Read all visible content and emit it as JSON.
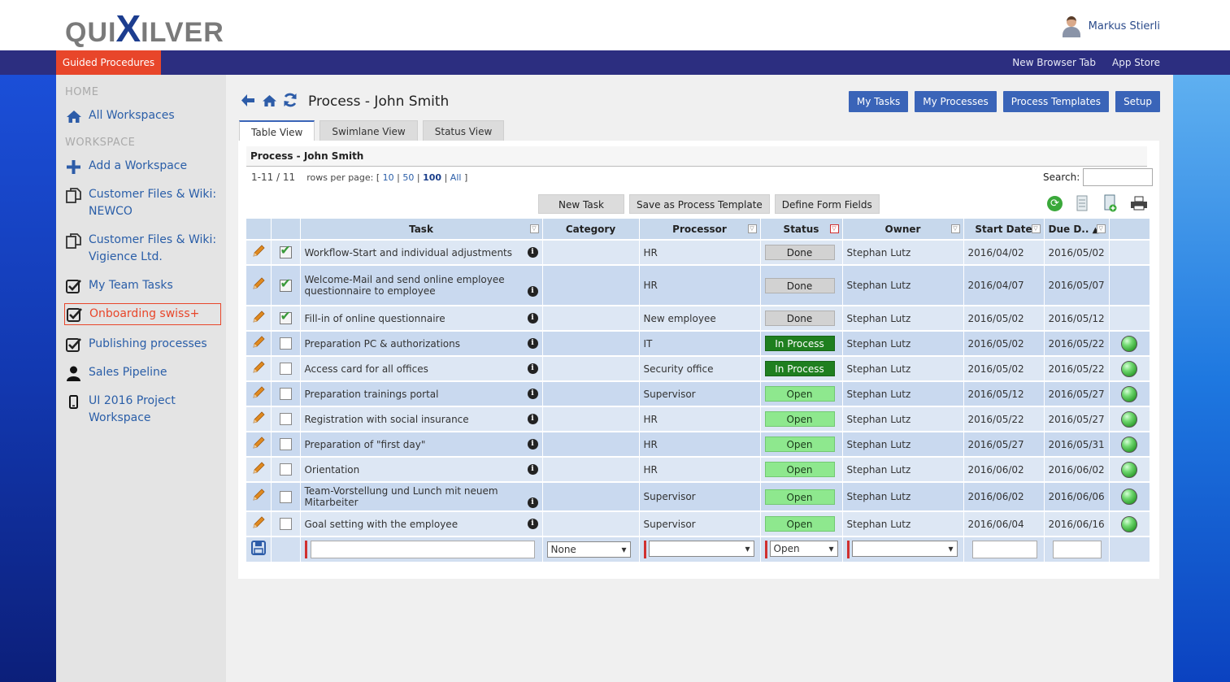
{
  "header": {
    "logo_pre": "QUI",
    "logo_x": "X",
    "logo_post": "ILVER",
    "user_name": "Markus Stierli"
  },
  "nav": {
    "active": "Guided Procedures",
    "links": [
      "New Browser Tab",
      "App Store"
    ]
  },
  "sidebar": {
    "home_label": "HOME",
    "workspace_label": "WORKSPACE",
    "items": [
      {
        "label": "All Workspaces",
        "icon": "home-icon"
      },
      {
        "label": "Add a Workspace",
        "icon": "plus-icon"
      },
      {
        "label": "Customer Files & Wiki: NEWCO",
        "icon": "copy-icon"
      },
      {
        "label": "Customer Files & Wiki: Vigience Ltd.",
        "icon": "copy-icon"
      },
      {
        "label": "My Team Tasks",
        "icon": "checkbox-icon"
      },
      {
        "label": "Onboarding swiss+",
        "icon": "checkbox-icon"
      },
      {
        "label": "Publishing processes",
        "icon": "checkbox-icon"
      },
      {
        "label": "Sales Pipeline",
        "icon": "user-icon"
      },
      {
        "label": "UI 2016 Project Workspace",
        "icon": "mobile-icon"
      }
    ]
  },
  "main": {
    "title": "Process - John Smith",
    "top_buttons": [
      "My Tasks",
      "My Processes",
      "Process Templates",
      "Setup"
    ],
    "tabs": [
      "Table View",
      "Swimlane View",
      "Status View"
    ],
    "panel_title": "Process - John Smith",
    "pager": {
      "count": "1-11 / 11",
      "rows_label": "rows per page: [",
      "opt10": "10",
      "opt50": "50",
      "opt100": "100",
      "optAll": "All",
      "sep": "|",
      "close": "]"
    },
    "search_label": "Search:",
    "actions": [
      "New Task",
      "Save as Process Template",
      "Define Form Fields"
    ]
  },
  "table": {
    "headers": [
      "Task",
      "Category",
      "Processor",
      "Status",
      "Owner",
      "Start Date",
      "Due D.."
    ],
    "rows": [
      {
        "task": "Workflow-Start and individual adjustments",
        "category": "",
        "processor": "HR",
        "status": "Done",
        "owner": "Stephan Lutz",
        "start": "2016/04/02",
        "due": "2016/05/02",
        "checked": true
      },
      {
        "task": "Welcome-Mail and send online employee questionnaire to employee",
        "category": "",
        "processor": "HR",
        "status": "Done",
        "owner": "Stephan Lutz",
        "start": "2016/04/07",
        "due": "2016/05/07",
        "checked": true
      },
      {
        "task": "Fill-in of online questionnaire",
        "category": "",
        "processor": "New employee",
        "status": "Done",
        "owner": "Stephan Lutz",
        "start": "2016/05/02",
        "due": "2016/05/12",
        "checked": true
      },
      {
        "task": "Preparation PC & authorizations",
        "category": "",
        "processor": "IT",
        "status": "In Process",
        "owner": "Stephan Lutz",
        "start": "2016/05/02",
        "due": "2016/05/22",
        "checked": false
      },
      {
        "task": "Access card for all offices",
        "category": "",
        "processor": "Security office",
        "status": "In Process",
        "owner": "Stephan Lutz",
        "start": "2016/05/02",
        "due": "2016/05/22",
        "checked": false
      },
      {
        "task": "Preparation trainings portal",
        "category": "",
        "processor": "Supervisor",
        "status": "Open",
        "owner": "Stephan Lutz",
        "start": "2016/05/12",
        "due": "2016/05/27",
        "checked": false
      },
      {
        "task": "Registration with social insurance",
        "category": "",
        "processor": "HR",
        "status": "Open",
        "owner": "Stephan Lutz",
        "start": "2016/05/22",
        "due": "2016/05/27",
        "checked": false
      },
      {
        "task": "Preparation of \"first day\"",
        "category": "",
        "processor": "HR",
        "status": "Open",
        "owner": "Stephan Lutz",
        "start": "2016/05/27",
        "due": "2016/05/31",
        "checked": false
      },
      {
        "task": "Orientation",
        "category": "",
        "processor": "HR",
        "status": "Open",
        "owner": "Stephan Lutz",
        "start": "2016/06/02",
        "due": "2016/06/02",
        "checked": false
      },
      {
        "task": "Team-Vorstellung und Lunch mit neuem Mitarbeiter",
        "category": "",
        "processor": "Supervisor",
        "status": "Open",
        "owner": "Stephan Lutz",
        "start": "2016/06/02",
        "due": "2016/06/06",
        "checked": false
      },
      {
        "task": "Goal setting with the employee",
        "category": "",
        "processor": "Supervisor",
        "status": "Open",
        "owner": "Stephan Lutz",
        "start": "2016/06/04",
        "due": "2016/06/16",
        "checked": false
      }
    ],
    "edit_row": {
      "category": "None",
      "status": "Open"
    }
  },
  "colors": {
    "nav_bg": "#2c2e80",
    "accent": "#e8462a",
    "button_blue": "#3a64b8",
    "done": "#d2d2d2",
    "in_process": "#1f7f1f",
    "open": "#8ee88e"
  }
}
